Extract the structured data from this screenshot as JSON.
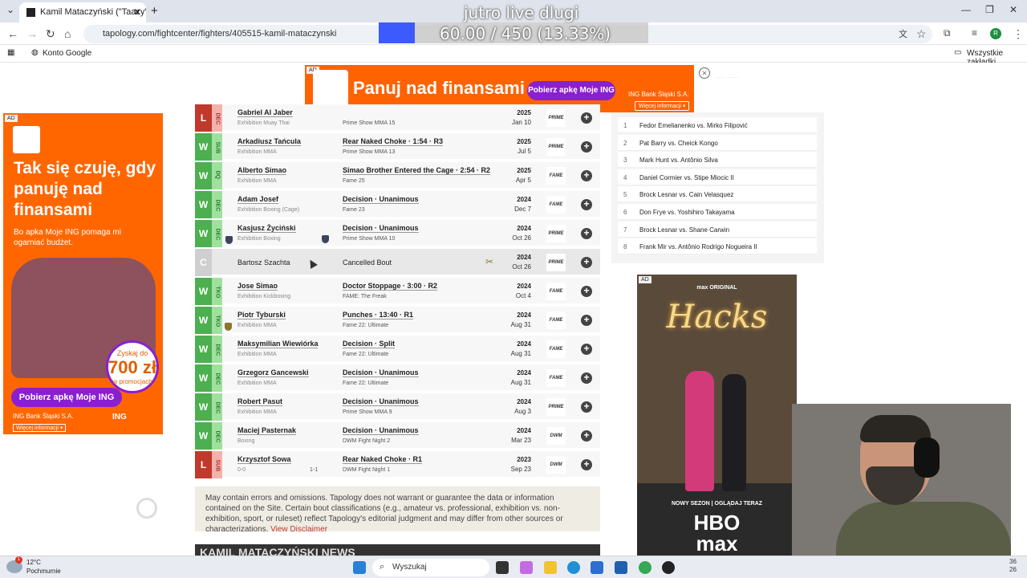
{
  "browser": {
    "tab_title": "Kamil Mataczyński (\"Taazy\") | M",
    "url": "tapology.com/fightcenter/fighters/405515-kamil-mataczynski",
    "bookmark": "Konto Google",
    "all_bookmarks": "Wszystkie zakładki",
    "profile_initial": "R"
  },
  "overlay": {
    "line1": "jutro live dlugi",
    "line2": "60.00 / 450 (13.33%)"
  },
  "top_ad": {
    "tag": "AD",
    "headline": "Panuj nad finansami",
    "button": "Pobierz apkę Moje ING",
    "org": "ING Bank Śląski S.A.",
    "more": "Więcej informacji ▾",
    "close": "⨯"
  },
  "left_ad": {
    "tag": "AD",
    "headline": "Tak się czuję, gdy panuję nad finansami",
    "body": "Bo apka Moje ING pomaga mi ogarniać budżet.",
    "promo_top": "Zyskaj do",
    "promo_amount": "700 zł",
    "promo_bottom": "w promocjach",
    "button": "Pobierz apkę Moje ING",
    "org": "ING Bank Śląski S.A.",
    "logo": "ING",
    "more": "Więcej informacji ▾"
  },
  "bouts": [
    {
      "result": "L",
      "method": "DEC",
      "opponent": "Gabriel Al Jaber",
      "bout_class": "Exhibition Muay Thai",
      "record": "",
      "summary": "",
      "event": "Prime Show MMA 15",
      "year": "2025",
      "date": "Jan 10",
      "promo": "PRIME",
      "color": "#c0392b"
    },
    {
      "result": "W",
      "method": "SUB",
      "opponent": "Arkadiusz Tańcula",
      "bout_class": "Exhibition MMA",
      "record": "",
      "summary": "Rear Naked Choke · 1:54 · R3",
      "event": "Prime Show MMA 13",
      "year": "2025",
      "date": "Jul 5",
      "promo": "PRIME",
      "color": "#4caf50"
    },
    {
      "result": "W",
      "method": "DQ",
      "opponent": "Alberto Simao",
      "bout_class": "Exhibition MMA",
      "record": "",
      "summary": "Simao Brother Entered the Cage · 2:54 · R2",
      "event": "Fame 25",
      "year": "2025",
      "date": "Apr 5",
      "promo": "FAME",
      "color": "#4caf50"
    },
    {
      "result": "W",
      "method": "DEC",
      "opponent": "Adam Josef",
      "bout_class": "Exhibition Boxing (Cage)",
      "record": "",
      "summary": "Decision · Unanimous",
      "event": "Fame 23",
      "year": "2024",
      "date": "Dec 7",
      "promo": "FAME",
      "color": "#4caf50"
    },
    {
      "result": "W",
      "method": "DEC",
      "opponent": "Kasjusz Życiński",
      "bout_class": "Exhibition Boxing",
      "record": "",
      "summary": "Decision · Unanimous",
      "event": "Prime Show MMA 10",
      "year": "2024",
      "date": "Oct 26",
      "promo": "PRIME",
      "color": "#4caf50"
    },
    {
      "result": "C",
      "method": "",
      "opponent": "Bartosz Szachta",
      "bout_class": "",
      "record": "",
      "summary": "Cancelled Bout",
      "event": "",
      "year": "2024",
      "date": "Oct 26",
      "promo": "PRIME",
      "color": "#cfcfcf"
    },
    {
      "result": "W",
      "method": "TKO",
      "opponent": "Jose Simao",
      "bout_class": "Exhibition Kickboxing",
      "record": "",
      "summary": "Doctor Stoppage · 3:00 · R2",
      "event": "FAME: The Freak",
      "year": "2024",
      "date": "Oct 4",
      "promo": "FAME",
      "color": "#4caf50"
    },
    {
      "result": "W",
      "method": "TKO",
      "opponent": "Piotr Tyburski",
      "bout_class": "Exhibition MMA",
      "record": "",
      "summary": "Punches · 13:40 · R1",
      "event": "Fame 22: Ultimate",
      "year": "2024",
      "date": "Aug 31",
      "promo": "FAME",
      "color": "#4caf50"
    },
    {
      "result": "W",
      "method": "DEC",
      "opponent": "Maksymilian Wiewiórka",
      "bout_class": "Exhibition MMA",
      "record": "",
      "summary": "Decision · Split",
      "event": "Fame 22: Ultimate",
      "year": "2024",
      "date": "Aug 31",
      "promo": "FAME",
      "color": "#4caf50"
    },
    {
      "result": "W",
      "method": "DEC",
      "opponent": "Grzegorz Gancewski",
      "bout_class": "Exhibition MMA",
      "record": "",
      "summary": "Decision · Unanimous",
      "event": "Fame 22: Ultimate",
      "year": "2024",
      "date": "Aug 31",
      "promo": "FAME",
      "color": "#4caf50"
    },
    {
      "result": "W",
      "method": "DEC",
      "opponent": "Robert Pasut",
      "bout_class": "Exhibition MMA",
      "record": "",
      "summary": "Decision · Unanimous",
      "event": "Prime Show MMA 9",
      "year": "2024",
      "date": "Aug 3",
      "promo": "PRIME",
      "color": "#4caf50"
    },
    {
      "result": "W",
      "method": "DEC",
      "opponent": "Maciej Pasternak",
      "bout_class": "Boxing",
      "record": "",
      "summary": "Decision · Unanimous",
      "event": "DWM Fight Night 2",
      "year": "2024",
      "date": "Mar 23",
      "promo": "DWM",
      "color": "#4caf50"
    },
    {
      "result": "L",
      "method": "SUB",
      "opponent": "Krzysztof Sowa",
      "bout_class": "0-0",
      "record": "1-1",
      "summary": "Rear Naked Choke · R1",
      "event": "DWM Fight Night 1",
      "year": "2023",
      "date": "Sep 23",
      "promo": "DWM",
      "color": "#c0392b"
    }
  ],
  "disclaimer": {
    "text": "May contain errors and omissions. Tapology does not warrant or guarantee the data or information contained on the Site. Certain bout classifications (e.g., amateur vs. professional, exhibition vs. non-exhibition, sport, or ruleset) reflect Tapology's editorial judgment and may differ from other sources or characterizations.",
    "link": "View Disclaimer"
  },
  "news_heading": "KAMIL MATACZYŃSKI NEWS",
  "top_fights": [
    {
      "n": "1",
      "t": "Fedor Emelianenko vs. Mirko Filipović"
    },
    {
      "n": "2",
      "t": "Pat Barry vs. Cheick Kongo"
    },
    {
      "n": "3",
      "t": "Mark Hunt vs. Antônio Silva"
    },
    {
      "n": "4",
      "t": "Daniel Cormier vs. Stipe Miocic II"
    },
    {
      "n": "5",
      "t": "Brock Lesnar vs. Cain Velasquez"
    },
    {
      "n": "6",
      "t": "Don Frye vs. Yoshihiro Takayama"
    },
    {
      "n": "7",
      "t": "Brock Lesnar vs. Shane Carwin"
    },
    {
      "n": "8",
      "t": "Frank Mir vs. Antônio Rodrigo Nogueira II"
    }
  ],
  "hbo_ad": {
    "tag": "AD",
    "original": "max ORIGINAL",
    "title": "Hacks",
    "tagline": "NOWY SEZON | OGLĄDAJ TERAZ",
    "logo_top": "HBO",
    "logo_bottom": "max"
  },
  "taskbar": {
    "temp": "12°C",
    "weather": "Pochmurnie",
    "search": "Wyszukaj",
    "badge": "1",
    "time_a": "36",
    "time_b": "26"
  }
}
